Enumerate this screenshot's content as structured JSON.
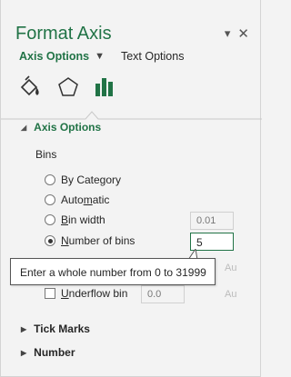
{
  "pane": {
    "title": "Format Axis",
    "pin_icon": "dropdown-caret-icon",
    "close_icon": "close-icon"
  },
  "tabs": {
    "active": "Axis Options",
    "other": "Text Options"
  },
  "icons": [
    "fill-line-icon",
    "effects-pentagon-icon",
    "axis-options-chart-icon"
  ],
  "sections": {
    "axis_options": "Axis Options",
    "tick_marks": "Tick Marks",
    "number": "Number"
  },
  "bins": {
    "label": "Bins",
    "by_category": "By Category",
    "automatic": "Automatic",
    "bin_width": "Bin width",
    "bin_width_value": "0.01",
    "number_of_bins": "Number of bins",
    "number_of_bins_value": "5",
    "overflow_hidden_auto": "Au",
    "underflow_bin": "Underflow bin",
    "underflow_value": "0.0",
    "underflow_auto": "Au",
    "selected": "number_of_bins"
  },
  "tooltip": {
    "text": "Enter a whole number from 0 to 31999"
  },
  "colors": {
    "accent": "#217346",
    "background": "#f3f3f3"
  }
}
